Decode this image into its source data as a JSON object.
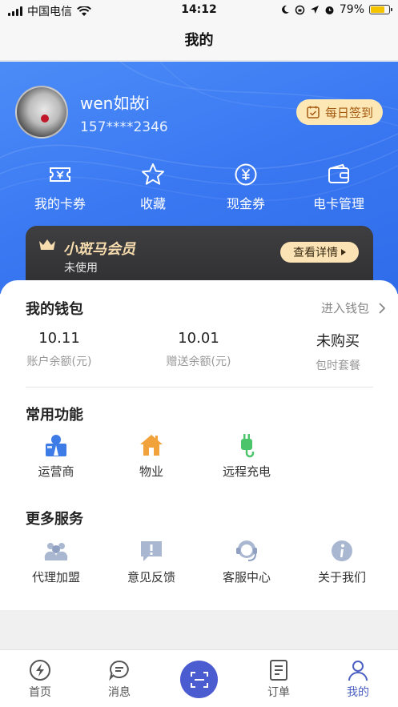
{
  "status_bar": {
    "carrier": "中国电信",
    "time": "14:12",
    "battery": "79%",
    "battery_level": 0.79
  },
  "nav": {
    "title": "我的"
  },
  "profile": {
    "username": "wen如故i",
    "phone": "157****2346",
    "checkin_label": "每日签到"
  },
  "shortcuts": [
    {
      "label": "我的卡券",
      "icon": "ticket-icon"
    },
    {
      "label": "收藏",
      "icon": "star-icon"
    },
    {
      "label": "现金券",
      "icon": "yen-coin-icon"
    },
    {
      "label": "电卡管理",
      "icon": "wallet-icon"
    }
  ],
  "vip": {
    "title": "小斑马会员",
    "status": "未使用",
    "button_label": "查看详情"
  },
  "wallet": {
    "title": "我的钱包",
    "link_label": "进入钱包",
    "stats": [
      {
        "value": "10.11",
        "label": "账户余额(元)"
      },
      {
        "value": "10.01",
        "label": "赠送余额(元)"
      },
      {
        "value": "未购买",
        "label": "包时套餐"
      }
    ]
  },
  "common_functions": {
    "title": "常用功能",
    "items": [
      {
        "label": "运营商",
        "icon": "operator-icon"
      },
      {
        "label": "物业",
        "icon": "house-icon"
      },
      {
        "label": "远程充电",
        "icon": "charging-plug-icon"
      }
    ]
  },
  "more_services": {
    "title": "更多服务",
    "items": [
      {
        "label": "代理加盟",
        "icon": "group-icon"
      },
      {
        "label": "意见反馈",
        "icon": "feedback-icon"
      },
      {
        "label": "客服中心",
        "icon": "customer-service-icon"
      },
      {
        "label": "关于我们",
        "icon": "info-icon"
      }
    ]
  },
  "tabs": [
    {
      "label": "首页",
      "icon": "lightning-icon"
    },
    {
      "label": "消息",
      "icon": "chat-bubble-icon"
    },
    {
      "label": "",
      "icon": "scan-icon"
    },
    {
      "label": "订单",
      "icon": "order-list-icon"
    },
    {
      "label": "我的",
      "icon": "person-icon"
    }
  ],
  "colors": {
    "brand_blue": "#3a78f2",
    "accent_tab": "#4b5fc2",
    "gold": "#fde7b4"
  }
}
